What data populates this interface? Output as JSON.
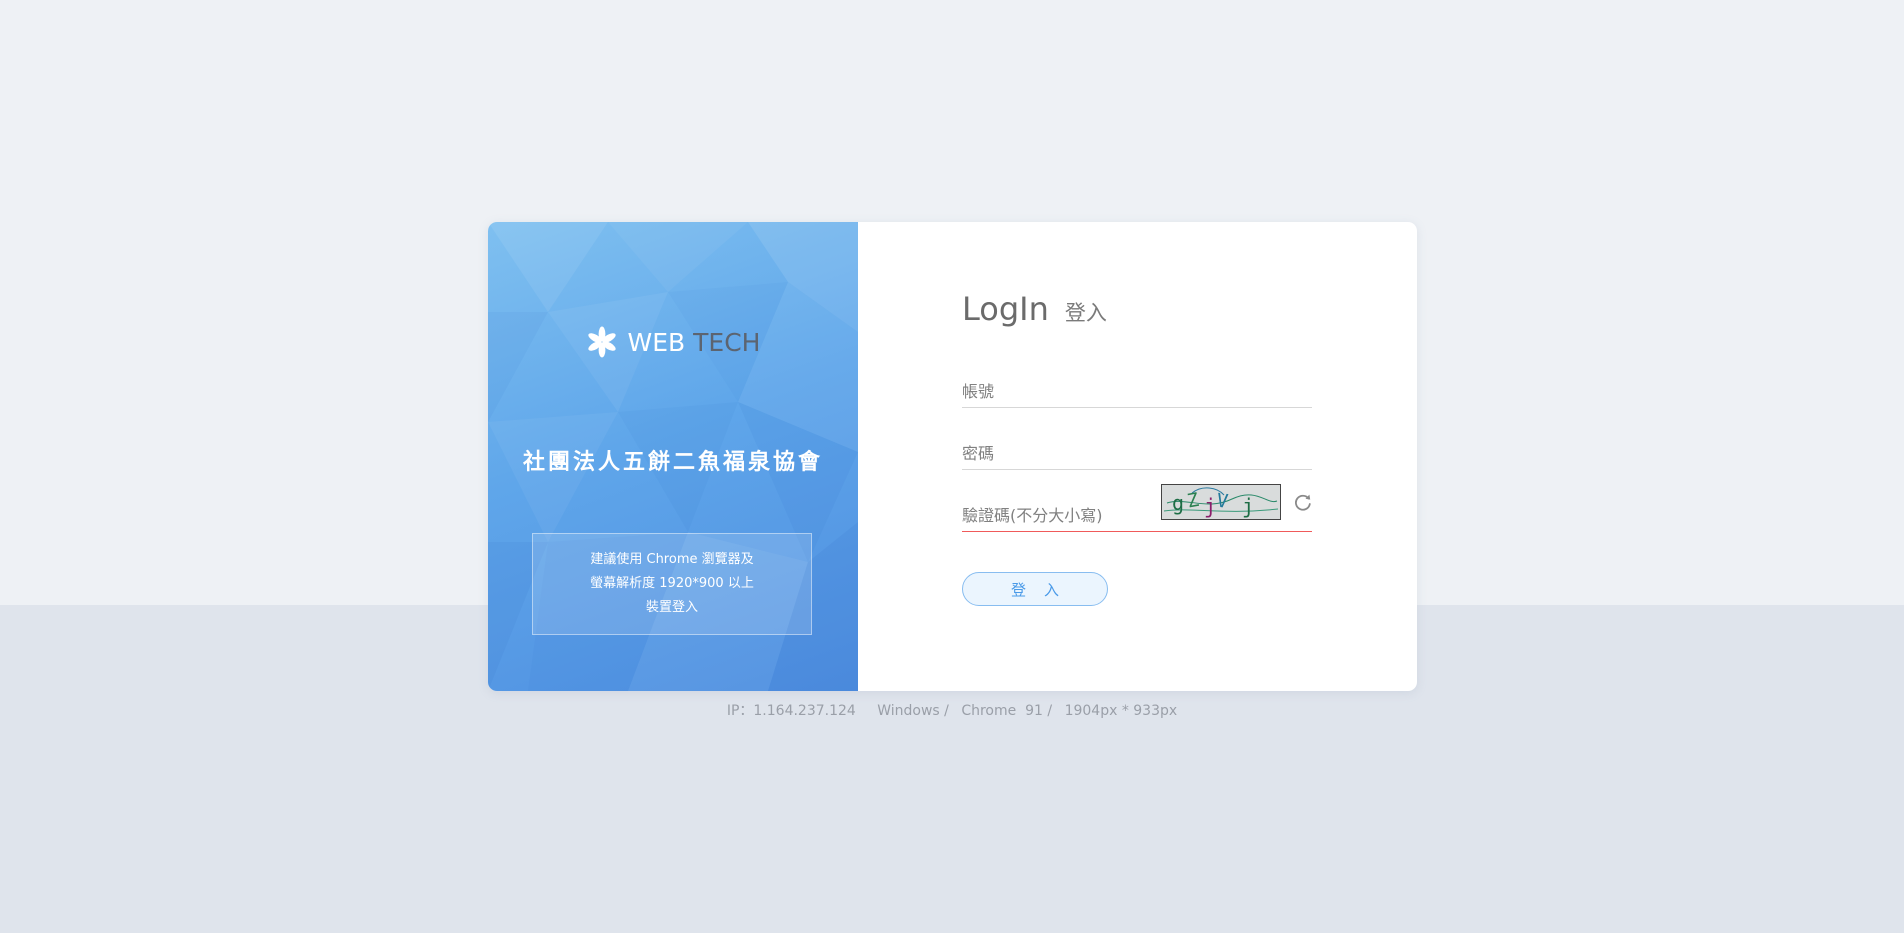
{
  "logo": {
    "icon": "asterisk-flower-icon",
    "text_part1": "WEB",
    "text_part2": "TECH"
  },
  "organization_name": "社團法人五餅二魚福泉協會",
  "notice": {
    "line1": "建議使用 Chrome 瀏覽器及",
    "line2": "螢幕解析度 1920*900 以上",
    "line3": "裝置登入"
  },
  "login": {
    "title_en": "LogIn",
    "title_zh": "登入",
    "account_placeholder": "帳號",
    "account_value": "",
    "password_placeholder": "密碼",
    "password_value": "",
    "captcha_placeholder": "驗證碼(不分大小寫)",
    "captcha_value": "",
    "captcha_text": "gZjV j",
    "refresh_icon": "refresh-icon",
    "submit_label": "登入"
  },
  "footer": {
    "ip": "IP：1.164.237.124",
    "os": "Windows /",
    "browser": "Chrome  91 /",
    "resolution": "1904px * 933px"
  },
  "colors": {
    "page_bg_top": "#eef1f5",
    "page_bg_bottom": "#dfe4ec",
    "panel_gradient_start": "#7fc0f0",
    "panel_gradient_end": "#4e8ee0",
    "accent": "#4a9ae8",
    "error_underline": "#f05a5a"
  }
}
